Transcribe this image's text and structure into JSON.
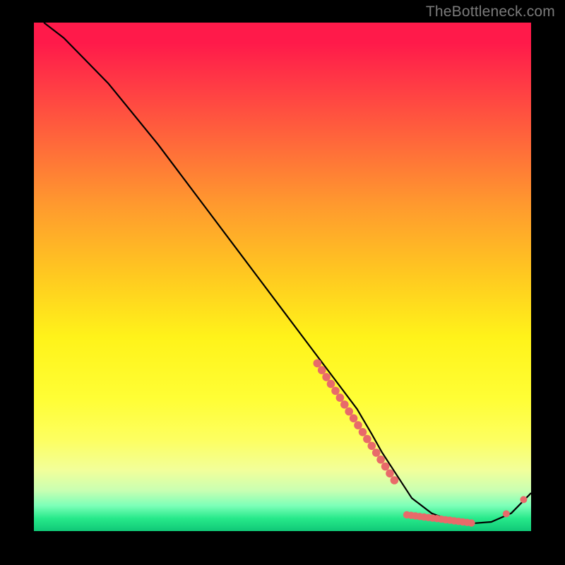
{
  "watermark": "TheBottleneck.com",
  "colors": {
    "curve": "#000000",
    "marker": "#e86a6a",
    "background": "#000000"
  },
  "chart_data": {
    "type": "line",
    "title": "",
    "xlabel": "",
    "ylabel": "",
    "xlim": [
      0,
      100
    ],
    "ylim": [
      0,
      100
    ],
    "series": [
      {
        "name": "curve",
        "x": [
          2,
          6,
          10,
          15,
          20,
          25,
          30,
          35,
          40,
          45,
          50,
          55,
          60,
          65,
          68,
          70,
          73,
          76,
          80,
          84,
          88,
          92,
          96,
          100
        ],
        "y": [
          100,
          97,
          93,
          88,
          82,
          76,
          69.5,
          63,
          56.5,
          50,
          43.5,
          37,
          30.5,
          24,
          19,
          15.5,
          11,
          6.5,
          3.5,
          2,
          1.5,
          1.8,
          3.5,
          7.5
        ]
      }
    ],
    "markers": {
      "cluster_diag": {
        "name": "descent-markers",
        "x_range": [
          57,
          72.5
        ],
        "y_range": [
          33,
          10
        ],
        "count": 18
      },
      "cluster_flat": {
        "name": "valley-markers",
        "x_range": [
          75,
          88
        ],
        "y_range": [
          3.2,
          1.6
        ],
        "count": 16
      },
      "tail_points": {
        "name": "tail-markers",
        "points": [
          {
            "x": 95,
            "y": 3.4
          },
          {
            "x": 98.5,
            "y": 6.2
          }
        ]
      }
    }
  }
}
